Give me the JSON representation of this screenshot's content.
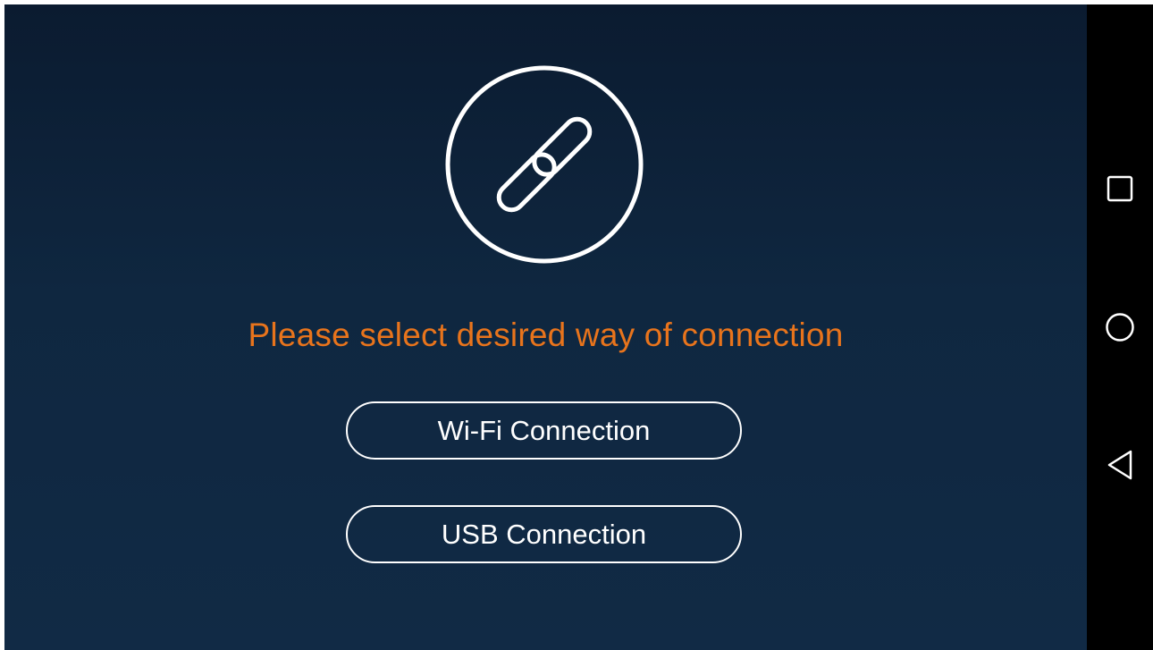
{
  "app": {
    "logo_icon": "chain-link-icon",
    "prompt": "Please select desired way of connection",
    "wifi_button_label": "Wi-Fi Connection",
    "usb_button_label": "USB Connection"
  },
  "nav_bar": {
    "recents_icon": "square-recents-icon",
    "home_icon": "circle-home-icon",
    "back_icon": "triangle-back-icon"
  },
  "colors": {
    "background_top": "#0b1b30",
    "background_bottom": "#112a45",
    "accent": "#e8741c",
    "foreground": "#ffffff",
    "nav_bar": "#000000"
  }
}
